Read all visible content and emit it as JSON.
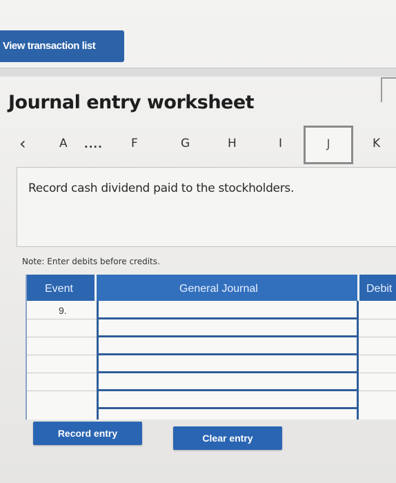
{
  "toolbar": {
    "view_transaction_list": "View transaction list"
  },
  "worksheet": {
    "title": "Journal entry worksheet",
    "nav": {
      "prev_icon": "chevron-left-icon",
      "tabs": [
        "A",
        "....",
        "F",
        "G",
        "H",
        "I",
        "J",
        "K"
      ],
      "active_tab": "J"
    },
    "prompt": "Record cash dividend paid to the stockholders.",
    "note": "Note: Enter debits before credits."
  },
  "journal": {
    "headers": {
      "event": "Event",
      "general_journal": "General Journal",
      "debit": "Debit"
    },
    "rows": [
      {
        "event": "9.",
        "general_journal": "",
        "debit": ""
      },
      {
        "event": "",
        "general_journal": "",
        "debit": ""
      },
      {
        "event": "",
        "general_journal": "",
        "debit": ""
      },
      {
        "event": "",
        "general_journal": "",
        "debit": ""
      },
      {
        "event": "",
        "general_journal": "",
        "debit": ""
      },
      {
        "event": "",
        "general_journal": "",
        "debit": ""
      }
    ]
  },
  "actions": {
    "record_entry": "Record entry",
    "clear_entry": "Clear entry"
  },
  "colors": {
    "accent": "#2c63a8",
    "header": "#2d66b0"
  }
}
